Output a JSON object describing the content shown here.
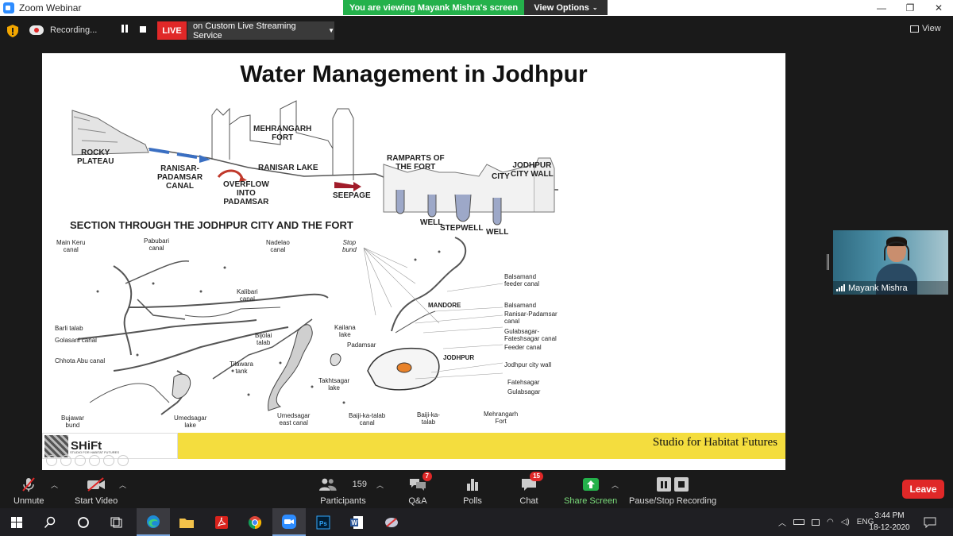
{
  "window": {
    "title": "Zoom Webinar",
    "controls": [
      "—",
      "❐",
      "✕"
    ]
  },
  "banner": {
    "viewing": "You are viewing Mayank Mishra's screen",
    "view_options": "View Options"
  },
  "recording": {
    "label": "Recording...",
    "live_label": "LIVE",
    "live_service": "on Custom Live Streaming Service"
  },
  "view_button": "View",
  "slide": {
    "title": "Water Management in Jodhpur",
    "section_heading": "SECTION THROUGH THE JODHPUR CITY AND THE FORT",
    "section_labels": {
      "rocky_plateau": "ROCKY\nPLATEAU",
      "ranisar_canal": "RANISAR-\nPADAMSAR\nCANAL",
      "overflow": "OVERFLOW\nINTO\nPADAMSAR",
      "fort": "MEHRANGARH\nFORT",
      "ranisar_lake": "RANISAR LAKE",
      "seepage": "SEEPAGE",
      "ramparts": "RAMPARTS OF\nTHE FORT",
      "city": "CITY",
      "city_wall": "JODHPUR\nCITY WALL",
      "well1": "WELL",
      "stepwell": "STEPWELL",
      "well2": "WELL"
    },
    "map_labels": {
      "main_keru": "Main Keru\ncanal",
      "pabubari": "Pabubari\ncanal",
      "nadelao": "Nadelao\ncanal",
      "stop_bund": "Stop\nbund",
      "balsamand_feeder": "Balsamand\nfeeder canal",
      "kalibari": "Kalibari\ncanal",
      "mandore": "MANDORE",
      "balsamand": "Balsamand",
      "ranisar_padamsar": "Ranisar-Padamsar\ncanal",
      "gulabsagar_fateh": "Gulabsagar-\nFateshsagar canal",
      "feeder_canal": "Feeder canal",
      "barli": "Barli talab",
      "golasani": "Golasani canal",
      "kailana": "Kailana\nlake",
      "bijolai": "Bijolai\ntalab",
      "padamsar": "Padamsar",
      "jodhpur": "JODHPUR",
      "city_wall": "Jodhpur city wall",
      "chhota_abu": "Chhota Abu canal",
      "tilawara": "Tilawara\ntank",
      "takhtsagar": "Takhtsagar\nlake",
      "fatehsagar": "Fatehsagar",
      "gulabsagar": "Gulabsagar",
      "bujawar": "Bujawar\nbund",
      "umedsagar_lake": "Umedsagar\nlake",
      "umedsagar_canal": "Umedsagar\neast canal",
      "baiji_canal": "Baiji-ka-talab\ncanal",
      "baiji_talab": "Baiji-ka-\ntalab",
      "mehrangarh_fort": "Mehrangarh\nFort"
    },
    "logo_text": "SHiFt",
    "logo_sub": "STUDIO FOR HABITAT FUTURES",
    "footer_text": "Studio for Habitat Futures"
  },
  "video": {
    "name": "Mayank Mishra"
  },
  "toolbar": {
    "unmute": "Unmute",
    "start_video": "Start Video",
    "participants": "Participants",
    "participants_count": "159",
    "qa": "Q&A",
    "qa_badge": "7",
    "polls": "Polls",
    "chat": "Chat",
    "chat_badge": "15",
    "share_screen": "Share Screen",
    "pause_stop": "Pause/Stop Recording",
    "leave": "Leave"
  },
  "taskbar": {
    "language": "ENG",
    "time": "3:44 PM",
    "date": "18-12-2020"
  },
  "colors": {
    "zoom_blue": "#2d8cff",
    "share_green": "#24b14b",
    "live_red": "#e02828",
    "footer_yellow": "#f4dd3e"
  }
}
